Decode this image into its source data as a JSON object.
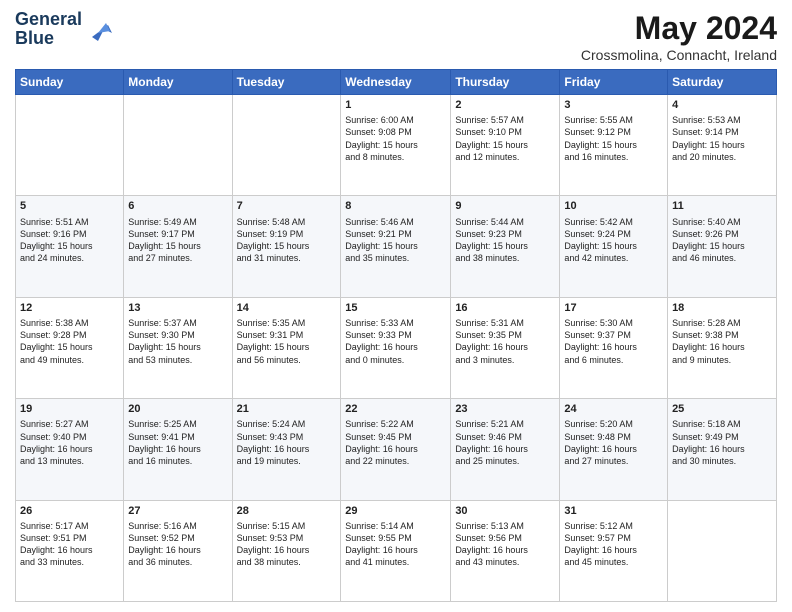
{
  "logo": {
    "line1": "General",
    "line2": "Blue"
  },
  "title": "May 2024",
  "subtitle": "Crossmolina, Connacht, Ireland",
  "weekdays": [
    "Sunday",
    "Monday",
    "Tuesday",
    "Wednesday",
    "Thursday",
    "Friday",
    "Saturday"
  ],
  "weeks": [
    [
      {
        "day": "",
        "info": ""
      },
      {
        "day": "",
        "info": ""
      },
      {
        "day": "",
        "info": ""
      },
      {
        "day": "1",
        "info": "Sunrise: 6:00 AM\nSunset: 9:08 PM\nDaylight: 15 hours\nand 8 minutes."
      },
      {
        "day": "2",
        "info": "Sunrise: 5:57 AM\nSunset: 9:10 PM\nDaylight: 15 hours\nand 12 minutes."
      },
      {
        "day": "3",
        "info": "Sunrise: 5:55 AM\nSunset: 9:12 PM\nDaylight: 15 hours\nand 16 minutes."
      },
      {
        "day": "4",
        "info": "Sunrise: 5:53 AM\nSunset: 9:14 PM\nDaylight: 15 hours\nand 20 minutes."
      }
    ],
    [
      {
        "day": "5",
        "info": "Sunrise: 5:51 AM\nSunset: 9:16 PM\nDaylight: 15 hours\nand 24 minutes."
      },
      {
        "day": "6",
        "info": "Sunrise: 5:49 AM\nSunset: 9:17 PM\nDaylight: 15 hours\nand 27 minutes."
      },
      {
        "day": "7",
        "info": "Sunrise: 5:48 AM\nSunset: 9:19 PM\nDaylight: 15 hours\nand 31 minutes."
      },
      {
        "day": "8",
        "info": "Sunrise: 5:46 AM\nSunset: 9:21 PM\nDaylight: 15 hours\nand 35 minutes."
      },
      {
        "day": "9",
        "info": "Sunrise: 5:44 AM\nSunset: 9:23 PM\nDaylight: 15 hours\nand 38 minutes."
      },
      {
        "day": "10",
        "info": "Sunrise: 5:42 AM\nSunset: 9:24 PM\nDaylight: 15 hours\nand 42 minutes."
      },
      {
        "day": "11",
        "info": "Sunrise: 5:40 AM\nSunset: 9:26 PM\nDaylight: 15 hours\nand 46 minutes."
      }
    ],
    [
      {
        "day": "12",
        "info": "Sunrise: 5:38 AM\nSunset: 9:28 PM\nDaylight: 15 hours\nand 49 minutes."
      },
      {
        "day": "13",
        "info": "Sunrise: 5:37 AM\nSunset: 9:30 PM\nDaylight: 15 hours\nand 53 minutes."
      },
      {
        "day": "14",
        "info": "Sunrise: 5:35 AM\nSunset: 9:31 PM\nDaylight: 15 hours\nand 56 minutes."
      },
      {
        "day": "15",
        "info": "Sunrise: 5:33 AM\nSunset: 9:33 PM\nDaylight: 16 hours\nand 0 minutes."
      },
      {
        "day": "16",
        "info": "Sunrise: 5:31 AM\nSunset: 9:35 PM\nDaylight: 16 hours\nand 3 minutes."
      },
      {
        "day": "17",
        "info": "Sunrise: 5:30 AM\nSunset: 9:37 PM\nDaylight: 16 hours\nand 6 minutes."
      },
      {
        "day": "18",
        "info": "Sunrise: 5:28 AM\nSunset: 9:38 PM\nDaylight: 16 hours\nand 9 minutes."
      }
    ],
    [
      {
        "day": "19",
        "info": "Sunrise: 5:27 AM\nSunset: 9:40 PM\nDaylight: 16 hours\nand 13 minutes."
      },
      {
        "day": "20",
        "info": "Sunrise: 5:25 AM\nSunset: 9:41 PM\nDaylight: 16 hours\nand 16 minutes."
      },
      {
        "day": "21",
        "info": "Sunrise: 5:24 AM\nSunset: 9:43 PM\nDaylight: 16 hours\nand 19 minutes."
      },
      {
        "day": "22",
        "info": "Sunrise: 5:22 AM\nSunset: 9:45 PM\nDaylight: 16 hours\nand 22 minutes."
      },
      {
        "day": "23",
        "info": "Sunrise: 5:21 AM\nSunset: 9:46 PM\nDaylight: 16 hours\nand 25 minutes."
      },
      {
        "day": "24",
        "info": "Sunrise: 5:20 AM\nSunset: 9:48 PM\nDaylight: 16 hours\nand 27 minutes."
      },
      {
        "day": "25",
        "info": "Sunrise: 5:18 AM\nSunset: 9:49 PM\nDaylight: 16 hours\nand 30 minutes."
      }
    ],
    [
      {
        "day": "26",
        "info": "Sunrise: 5:17 AM\nSunset: 9:51 PM\nDaylight: 16 hours\nand 33 minutes."
      },
      {
        "day": "27",
        "info": "Sunrise: 5:16 AM\nSunset: 9:52 PM\nDaylight: 16 hours\nand 36 minutes."
      },
      {
        "day": "28",
        "info": "Sunrise: 5:15 AM\nSunset: 9:53 PM\nDaylight: 16 hours\nand 38 minutes."
      },
      {
        "day": "29",
        "info": "Sunrise: 5:14 AM\nSunset: 9:55 PM\nDaylight: 16 hours\nand 41 minutes."
      },
      {
        "day": "30",
        "info": "Sunrise: 5:13 AM\nSunset: 9:56 PM\nDaylight: 16 hours\nand 43 minutes."
      },
      {
        "day": "31",
        "info": "Sunrise: 5:12 AM\nSunset: 9:57 PM\nDaylight: 16 hours\nand 45 minutes."
      },
      {
        "day": "",
        "info": ""
      }
    ]
  ]
}
